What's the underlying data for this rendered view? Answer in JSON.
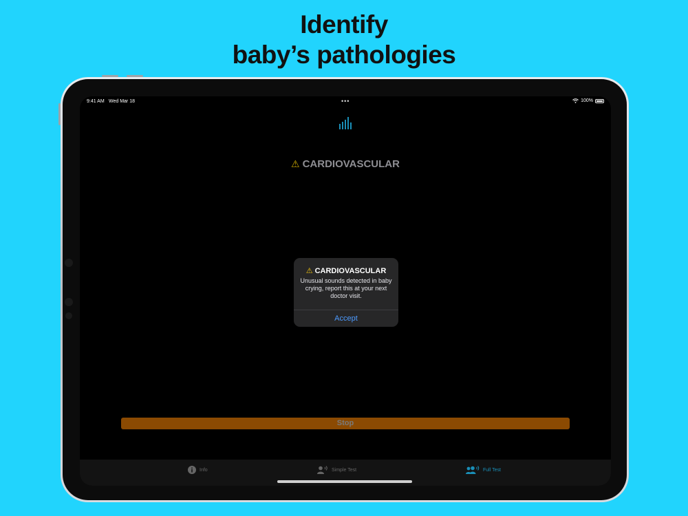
{
  "headline": {
    "line1": "Identify",
    "line2": "baby’s pathologies"
  },
  "status_bar": {
    "time": "9:41 AM",
    "date": "Wed Mar 18",
    "dots": "•••",
    "battery": "100%"
  },
  "main": {
    "warning_icon": "⚠",
    "warning_title": "CARDIOVASCULAR"
  },
  "alert": {
    "icon": "⚠",
    "title": "CARDIOVASCULAR",
    "message": "Unusual sounds detected in baby crying, report this at your next doctor visit.",
    "action": "Accept"
  },
  "stop_button": {
    "label": "Stop"
  },
  "tabs": [
    {
      "label": "Info",
      "icon": "info-icon"
    },
    {
      "label": "Simple Test",
      "icon": "person-sound-icon"
    },
    {
      "label": "Full Test",
      "icon": "people-sound-icon"
    }
  ],
  "colors": {
    "background": "#21d4fd",
    "accent": "#1a8fb8",
    "stop_button": "#8b4a02",
    "alert_action": "#4d9bff",
    "warning": "#f1c40f"
  }
}
